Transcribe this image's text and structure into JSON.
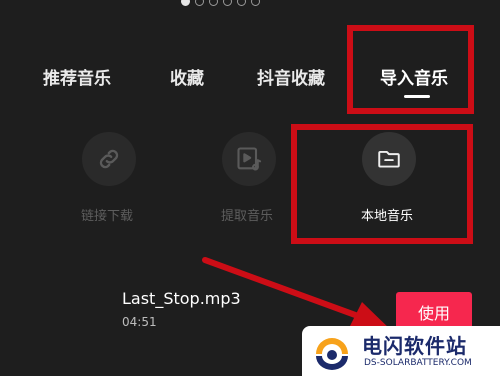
{
  "page_dots": {
    "count": 6,
    "active_index": 0
  },
  "tabs": [
    {
      "label": "推荐音乐",
      "selected": false
    },
    {
      "label": "收藏",
      "selected": false
    },
    {
      "label": "抖音收藏",
      "selected": false
    },
    {
      "label": "导入音乐",
      "selected": true
    }
  ],
  "import_options": [
    {
      "label": "链接下载",
      "icon": "link-icon",
      "enabled": false
    },
    {
      "label": "提取音乐",
      "icon": "video-music-icon",
      "enabled": false
    },
    {
      "label": "本地音乐",
      "icon": "folder-icon",
      "enabled": true
    }
  ],
  "song": {
    "name": "Last_Stop.mp3",
    "duration": "04:51",
    "use_label": "使用"
  },
  "watermark": {
    "title": "电闪软件站",
    "subtitle": "DS-SOLARBATTERY.COM"
  },
  "colors": {
    "background": "#1e1e1e",
    "highlight_red": "#cc0d16",
    "use_button": "#f6274e",
    "watermark_text": "#1b2a6b"
  }
}
